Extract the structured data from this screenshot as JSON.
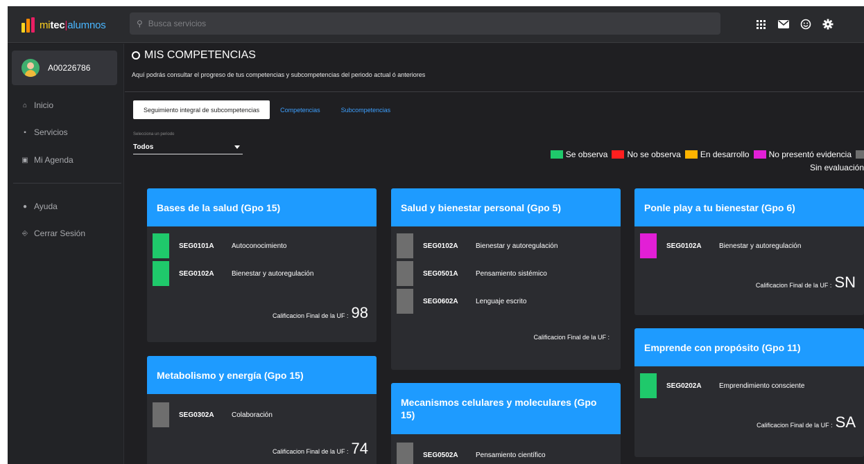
{
  "app": {
    "logo_mi": "mi",
    "logo_tec": "tec",
    "logo_sep": "|",
    "logo_alumnos": "alumnos",
    "logo_bar_colors": [
      "#ffd21f",
      "#ff8a00",
      "#e91e63",
      "#49b6ff"
    ]
  },
  "search": {
    "placeholder": "Busca servicios"
  },
  "top_icons": [
    "apps-grid-icon",
    "mail-icon",
    "smiley-icon",
    "gear-icon"
  ],
  "sidebar": {
    "user_id": "A00226786",
    "items": [
      {
        "label": "Inicio",
        "icon": "home-icon",
        "glyph": "⌂"
      },
      {
        "label": "Servicios",
        "icon": "grid-icon",
        "glyph": "▪"
      },
      {
        "label": "Mi Agenda",
        "icon": "calendar-icon",
        "glyph": "▣"
      },
      {
        "label": "Ayuda",
        "icon": "help-icon",
        "glyph": "●"
      },
      {
        "label": "Cerrar Sesión",
        "icon": "logout-icon",
        "glyph": "⎆"
      }
    ]
  },
  "page": {
    "title": "MIS COMPETENCIAS",
    "subtitle": "Aquí podrás consultar el progreso de tus competencias y subcompetencias del periodo actual ó anteriores"
  },
  "tabs": [
    {
      "label": "Seguimiento integral de subcompetencias",
      "active": true
    },
    {
      "label": "Competencias",
      "active": false
    },
    {
      "label": "Subcompetencias",
      "active": false
    }
  ],
  "period": {
    "label": "Selecciona un periodo",
    "value": "Todos"
  },
  "legend": [
    {
      "label": "Se observa",
      "color": "#1fc96b"
    },
    {
      "label": "No se observa",
      "color": "#ff1f1f"
    },
    {
      "label": "En desarrollo",
      "color": "#ffb400"
    },
    {
      "label": "No presentó evidencia",
      "color": "#e21fd6"
    },
    {
      "label": "Sin evaluación",
      "color": "#6e6e6e"
    }
  ],
  "final_label": "Calificacion Final de la UF :",
  "cards": [
    {
      "title": "Bases de la salud (Gpo 15)",
      "subs": [
        {
          "code": "SEG0101A",
          "name": "Autoconocimiento",
          "color": "#1fc96b"
        },
        {
          "code": "SEG0102A",
          "name": "Bienestar y autoregulación",
          "color": "#1fc96b"
        }
      ],
      "grade": "98"
    },
    {
      "title": "Salud y bienestar personal (Gpo 5)",
      "subs": [
        {
          "code": "SEG0102A",
          "name": "Bienestar y autoregulación",
          "color": "#6e6e6e"
        },
        {
          "code": "SEG0501A",
          "name": "Pensamiento sistémico",
          "color": "#6e6e6e"
        },
        {
          "code": "SEG0602A",
          "name": "Lenguaje escrito",
          "color": "#6e6e6e"
        }
      ],
      "grade": ""
    },
    {
      "title": "Ponle play a tu bienestar (Gpo 6)",
      "subs": [
        {
          "code": "SEG0102A",
          "name": "Bienestar y autoregulación",
          "color": "#e21fd6"
        }
      ],
      "grade": "SN"
    },
    {
      "title": "Metabolismo y energía (Gpo 15)",
      "subs": [
        {
          "code": "SEG0302A",
          "name": "Colaboración",
          "color": "#6e6e6e"
        }
      ],
      "grade": "74"
    },
    {
      "title": "Mecanismos celulares y moleculares (Gpo 15)",
      "subs": [
        {
          "code": "SEG0502A",
          "name": "Pensamiento científico",
          "color": "#6e6e6e"
        }
      ],
      "grade": ""
    },
    {
      "title": "Emprende con propósito (Gpo 11)",
      "subs": [
        {
          "code": "SEG0202A",
          "name": "Emprendimiento consciente",
          "color": "#1fc96b"
        }
      ],
      "grade": "SA"
    }
  ]
}
